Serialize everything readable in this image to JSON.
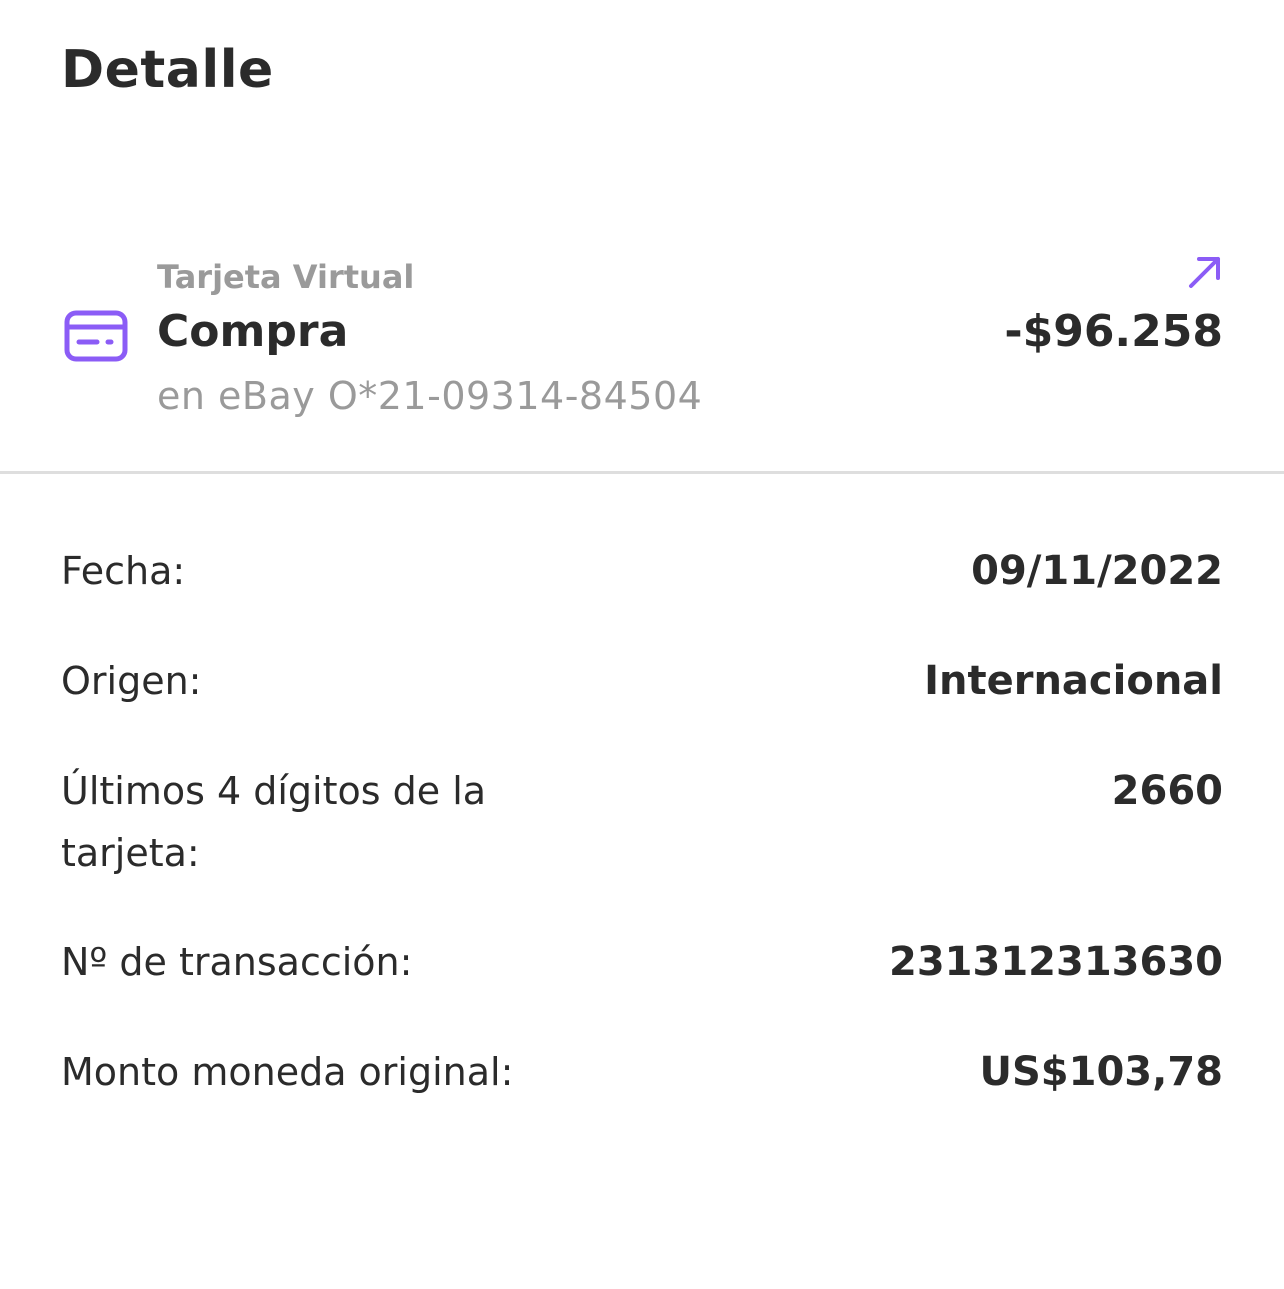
{
  "header": {
    "title": "Detalle"
  },
  "transaction": {
    "category": "Tarjeta Virtual",
    "type": "Compra",
    "merchant": "en eBay O*21-09314-84504",
    "amount": "-$96.258",
    "icon": "credit-card-icon",
    "direction_icon": "arrow-up-right-icon",
    "accent_color": "#8b5cf6"
  },
  "details": {
    "fecha": {
      "label": "Fecha:",
      "value": "09/11/2022"
    },
    "origen": {
      "label": "Origen:",
      "value": "Internacional"
    },
    "digitos": {
      "label": "Últimos 4 dígitos de la tarjeta:",
      "value": "2660"
    },
    "transaccion": {
      "label": "Nº de transacción:",
      "value": "231312313630"
    },
    "monto": {
      "label": "Monto moneda original:",
      "value": "US$103,78"
    }
  }
}
